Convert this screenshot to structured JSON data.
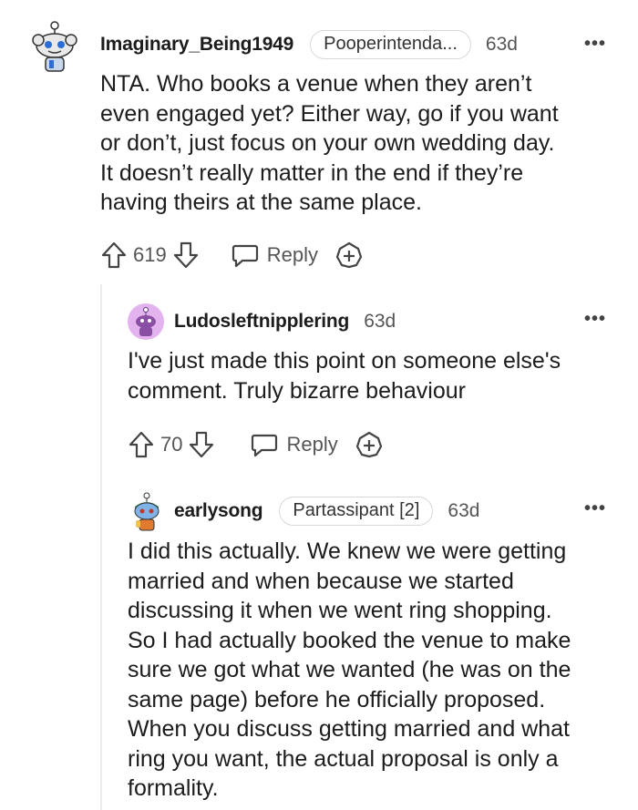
{
  "comments": [
    {
      "username": "Imaginary_Being1949",
      "flair": "Pooperintenda...",
      "time": "63d",
      "more": "•••",
      "body": [
        "NTA. Who books a venue when they aren’t",
        "even engaged yet? Either way, go if you want",
        "or don’t, just focus on your own wedding day.",
        "It doesn’t really matter in the end if they’re",
        "having theirs at the same place."
      ],
      "votes": "619",
      "reply_label": "Reply",
      "avatar_icon": "snoo-avatar-icon"
    },
    {
      "username": "Ludosleftnipplering",
      "time": "63d",
      "more": "•••",
      "body": [
        "I've just made this point on someone else's",
        "comment. Truly bizarre behaviour"
      ],
      "votes": "70",
      "reply_label": "Reply",
      "avatar_icon": "snoo-avatar-icon"
    },
    {
      "username": "earlysong",
      "flair": "Partassipant [2]",
      "time": "63d",
      "more": "•••",
      "body": [
        "I did this actually. We knew we were getting",
        "married and when because we started",
        "discussing it when we went ring shopping.",
        "So I had actually booked the venue to make",
        "sure we got what we wanted (he was on the",
        "same page) before he officially proposed.",
        "When you discuss getting married and what",
        "ring you want, the actual proposal is only a",
        "formality."
      ],
      "avatar_icon": "snoo-avatar-icon"
    }
  ],
  "colors": {
    "text": "#1c1c1c",
    "meta": "#555555",
    "thread_line": "#ececec",
    "avatar2_bg": "#e3b3f0"
  }
}
